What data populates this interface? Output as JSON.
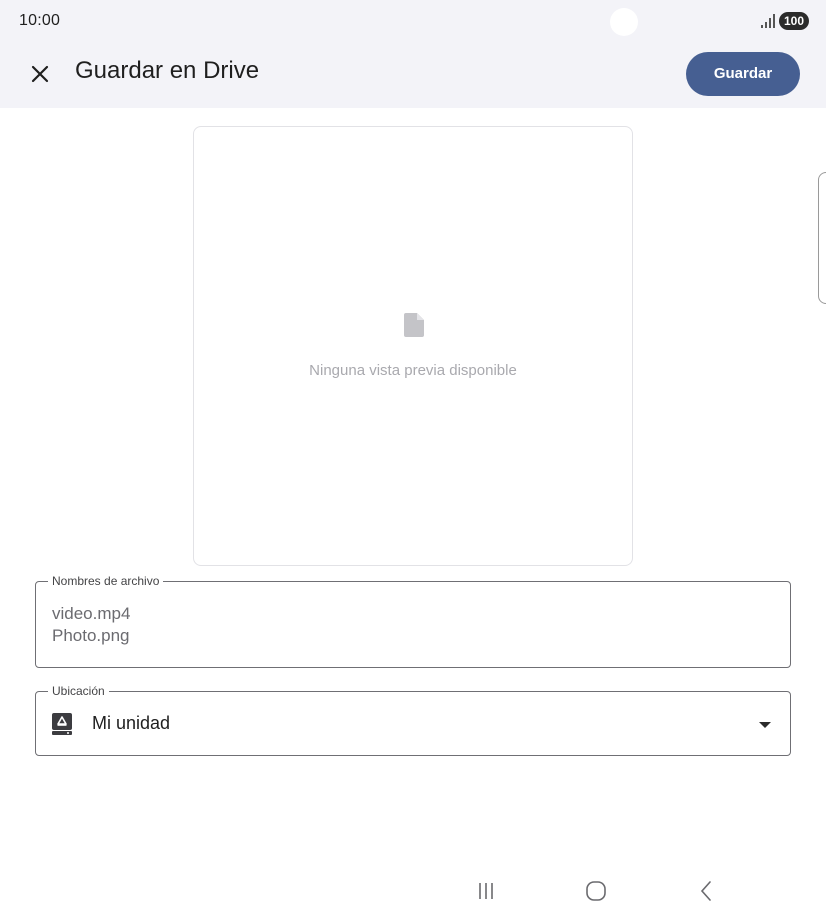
{
  "status_bar": {
    "time": "10:00",
    "battery": "100",
    "icons": [
      "signal-icon",
      "battery-icon"
    ]
  },
  "app_bar": {
    "close_icon": "close-icon",
    "title": "Guardar en Drive",
    "save_label": "Guardar"
  },
  "preview": {
    "icon": "file-icon",
    "message": "Ninguna vista previa disponible"
  },
  "filenames": {
    "label": "Nombres de archivo",
    "values": [
      "video.mp4",
      "Photo.png"
    ]
  },
  "location": {
    "label": "Ubicación",
    "icon": "drive-icon",
    "value": "Mi unidad",
    "dropdown_icon": "dropdown-arrow-icon"
  },
  "nav_bar": {
    "icons": [
      "recents-icon",
      "home-icon",
      "back-icon"
    ]
  },
  "colors": {
    "accent": "#465f92",
    "header_background": "#f3f3f8",
    "border": "#6f6f74"
  }
}
